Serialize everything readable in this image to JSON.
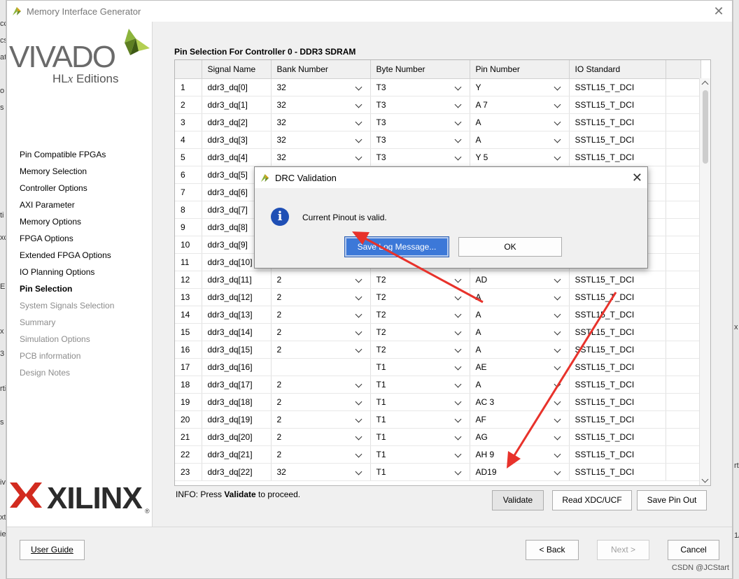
{
  "background": {
    "left_fragments": [
      "cc",
      "cs",
      "at",
      "o",
      "s",
      "ti",
      "xc",
      "E",
      "x",
      "3",
      "rti",
      "s",
      "iv",
      "xt",
      "ie"
    ],
    "right_fragments": [
      "x",
      "rt",
      "1/"
    ]
  },
  "window": {
    "title": "Memory Interface Generator",
    "close_label": "✕"
  },
  "branding": {
    "vivado": "VIVADO",
    "hlx_prefix": "HL",
    "hlx_italic": "x",
    "hlx_suffix": " Editions",
    "xilinx": "XILINX",
    "registered": "®"
  },
  "steps": [
    {
      "label": "Pin Compatible FPGAs",
      "state": "normal"
    },
    {
      "label": "Memory Selection",
      "state": "normal"
    },
    {
      "label": "Controller Options",
      "state": "normal"
    },
    {
      "label": "AXI Parameter",
      "state": "normal"
    },
    {
      "label": "Memory Options",
      "state": "normal"
    },
    {
      "label": "FPGA Options",
      "state": "normal"
    },
    {
      "label": "Extended FPGA Options",
      "state": "normal"
    },
    {
      "label": "IO Planning Options",
      "state": "normal"
    },
    {
      "label": "Pin Selection",
      "state": "active"
    },
    {
      "label": "System Signals Selection",
      "state": "disabled"
    },
    {
      "label": "Summary",
      "state": "disabled"
    },
    {
      "label": "Simulation Options",
      "state": "disabled"
    },
    {
      "label": "PCB information",
      "state": "disabled"
    },
    {
      "label": "Design Notes",
      "state": "disabled"
    }
  ],
  "main": {
    "section_title": "Pin Selection For Controller 0 - DDR3 SDRAM",
    "columns": [
      "",
      "Signal Name",
      "Bank Number",
      "Byte Number",
      "Pin Number",
      "IO Standard"
    ],
    "rows": [
      [
        "1",
        "ddr3_dq[0]",
        "32",
        "T3",
        "Y",
        "SSTL15_T_DCI"
      ],
      [
        "2",
        "ddr3_dq[1]",
        "32",
        "T3",
        "A  7",
        "SSTL15_T_DCI"
      ],
      [
        "3",
        "ddr3_dq[2]",
        "32",
        "T3",
        "A",
        "SSTL15_T_DCI"
      ],
      [
        "4",
        "ddr3_dq[3]",
        "32",
        "T3",
        "A",
        "SSTL15_T_DCI"
      ],
      [
        "5",
        "ddr3_dq[4]",
        "32",
        "T3",
        "Y 5",
        "SSTL15_T_DCI"
      ],
      [
        "6",
        "ddr3_dq[5]",
        "",
        "",
        "",
        ""
      ],
      [
        "7",
        "ddr3_dq[6]",
        "",
        "",
        "",
        ""
      ],
      [
        "8",
        "ddr3_dq[7]",
        "",
        "",
        "",
        ""
      ],
      [
        "9",
        "ddr3_dq[8]",
        "",
        "",
        "",
        ""
      ],
      [
        "10",
        "ddr3_dq[9]",
        "",
        "",
        "",
        ""
      ],
      [
        "11",
        "ddr3_dq[10]",
        "",
        "",
        "",
        ""
      ],
      [
        "12",
        "ddr3_dq[11]",
        "2",
        "T2",
        "AD",
        "SSTL15_T_DCI"
      ],
      [
        "13",
        "ddr3_dq[12]",
        "2",
        "T2",
        "A",
        "SSTL15_T_DCI"
      ],
      [
        "14",
        "ddr3_dq[13]",
        "2",
        "T2",
        "A",
        "SSTL15_T_DCI"
      ],
      [
        "15",
        "ddr3_dq[14]",
        "2",
        "T2",
        "A",
        "SSTL15_T_DCI"
      ],
      [
        "16",
        "ddr3_dq[15]",
        "2",
        "T2",
        "A",
        "SSTL15_T_DCI"
      ],
      [
        "17",
        "ddr3_dq[16]",
        "",
        "T1",
        "AE",
        "SSTL15_T_DCI"
      ],
      [
        "18",
        "ddr3_dq[17]",
        "2",
        "T1",
        "A",
        "SSTL15_T_DCI"
      ],
      [
        "19",
        "ddr3_dq[18]",
        "2",
        "T1",
        "AC 3",
        "SSTL15_T_DCI"
      ],
      [
        "20",
        "ddr3_dq[19]",
        "2",
        "T1",
        "AF",
        "SSTL15_T_DCI"
      ],
      [
        "21",
        "ddr3_dq[20]",
        "2",
        "T1",
        "AG",
        "SSTL15_T_DCI"
      ],
      [
        "22",
        "ddr3_dq[21]",
        "2",
        "T1",
        "AH 9",
        "SSTL15_T_DCI"
      ],
      [
        "23",
        "ddr3_dq[22]",
        "32",
        "T1",
        "AD19",
        "SSTL15_T_DCI"
      ]
    ],
    "info_prefix": "INFO: Press ",
    "info_bold": "Validate",
    "info_suffix": " to proceed.",
    "validate_label": "Validate",
    "read_xdc_label": "Read XDC/UCF",
    "save_pin_label": "Save Pin Out"
  },
  "footer": {
    "user_guide_label": "User Guide",
    "back_label": "< Back",
    "next_label": "Next >",
    "cancel_label": "Cancel",
    "watermark": "CSDN @JCStart"
  },
  "dialog": {
    "title": "DRC Validation",
    "message": "Current Pinout is valid.",
    "save_log_label": "Save Log Message...",
    "ok_label": "OK",
    "close_label": "✕"
  },
  "colors": {
    "accent_button": "#3c78d8",
    "info_icon": "#1f4fb5",
    "annotation_arrow": "#e8322b",
    "vivado_mark": "#8cb43c"
  }
}
